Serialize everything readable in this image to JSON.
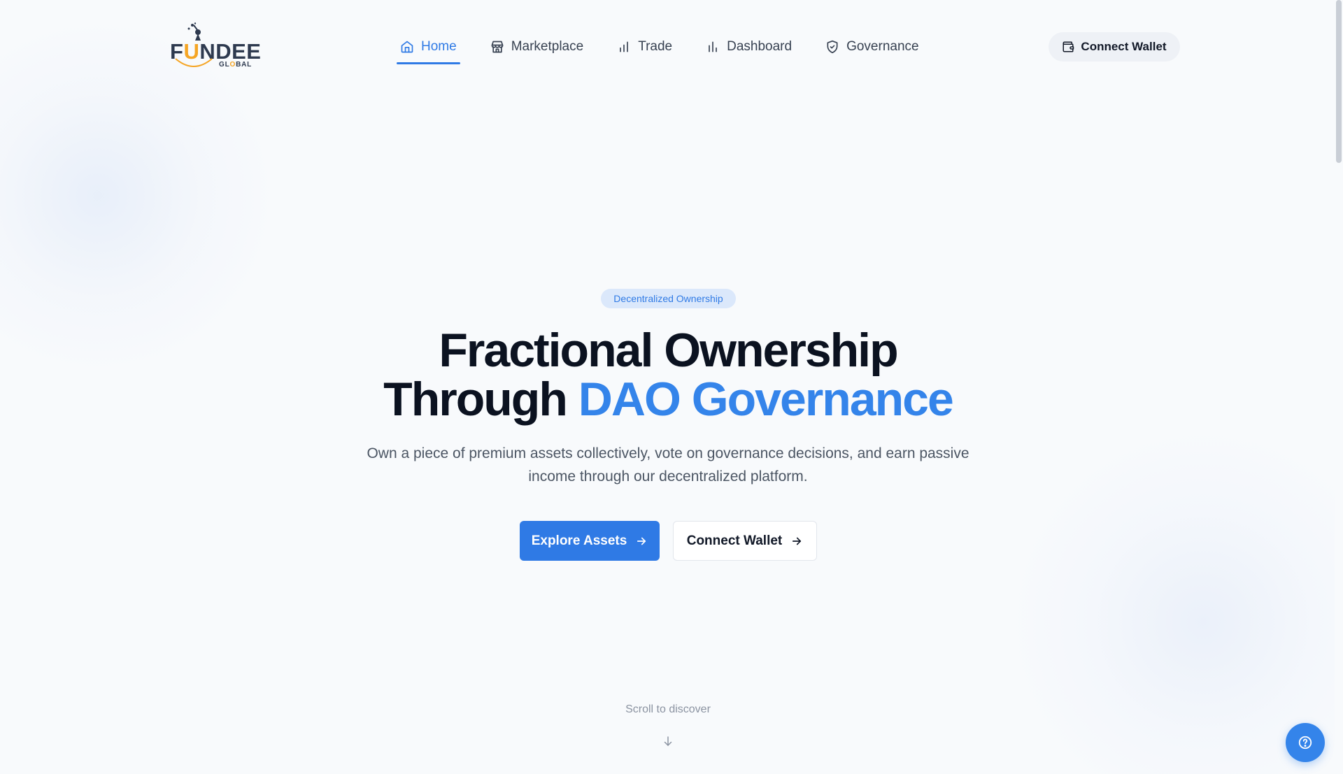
{
  "brand": {
    "logo_prefix": "F",
    "logo_u": "U",
    "logo_suffix": "NDEE",
    "logo_sub": "GL",
    "logo_sub_o": "O",
    "logo_sub_end": "BAL"
  },
  "nav": {
    "items": [
      {
        "label": "Home",
        "icon": "home-icon",
        "active": true
      },
      {
        "label": "Marketplace",
        "icon": "store-icon",
        "active": false
      },
      {
        "label": "Trade",
        "icon": "bar-chart-icon",
        "active": false
      },
      {
        "label": "Dashboard",
        "icon": "bar-chart-icon",
        "active": false
      },
      {
        "label": "Governance",
        "icon": "shield-check-icon",
        "active": false
      }
    ]
  },
  "header": {
    "connect_wallet_label": "Connect Wallet"
  },
  "hero": {
    "badge": "Decentralized Ownership",
    "title_line1": "Fractional Ownership",
    "title_line2_plain": "Through ",
    "title_line2_accent": "DAO Governance",
    "subtitle_line1": "Own a piece of premium assets collectively, vote on governance decisions, and earn passive",
    "subtitle_line2": "income through our decentralized platform.",
    "primary_button": "Explore Assets",
    "secondary_button": "Connect Wallet",
    "scroll_hint": "Scroll to discover"
  },
  "colors": {
    "accent": "#2f7ae5",
    "accent_light": "#dbe8fb",
    "logo_orange": "#f5a524",
    "background": "#f8fafc"
  }
}
